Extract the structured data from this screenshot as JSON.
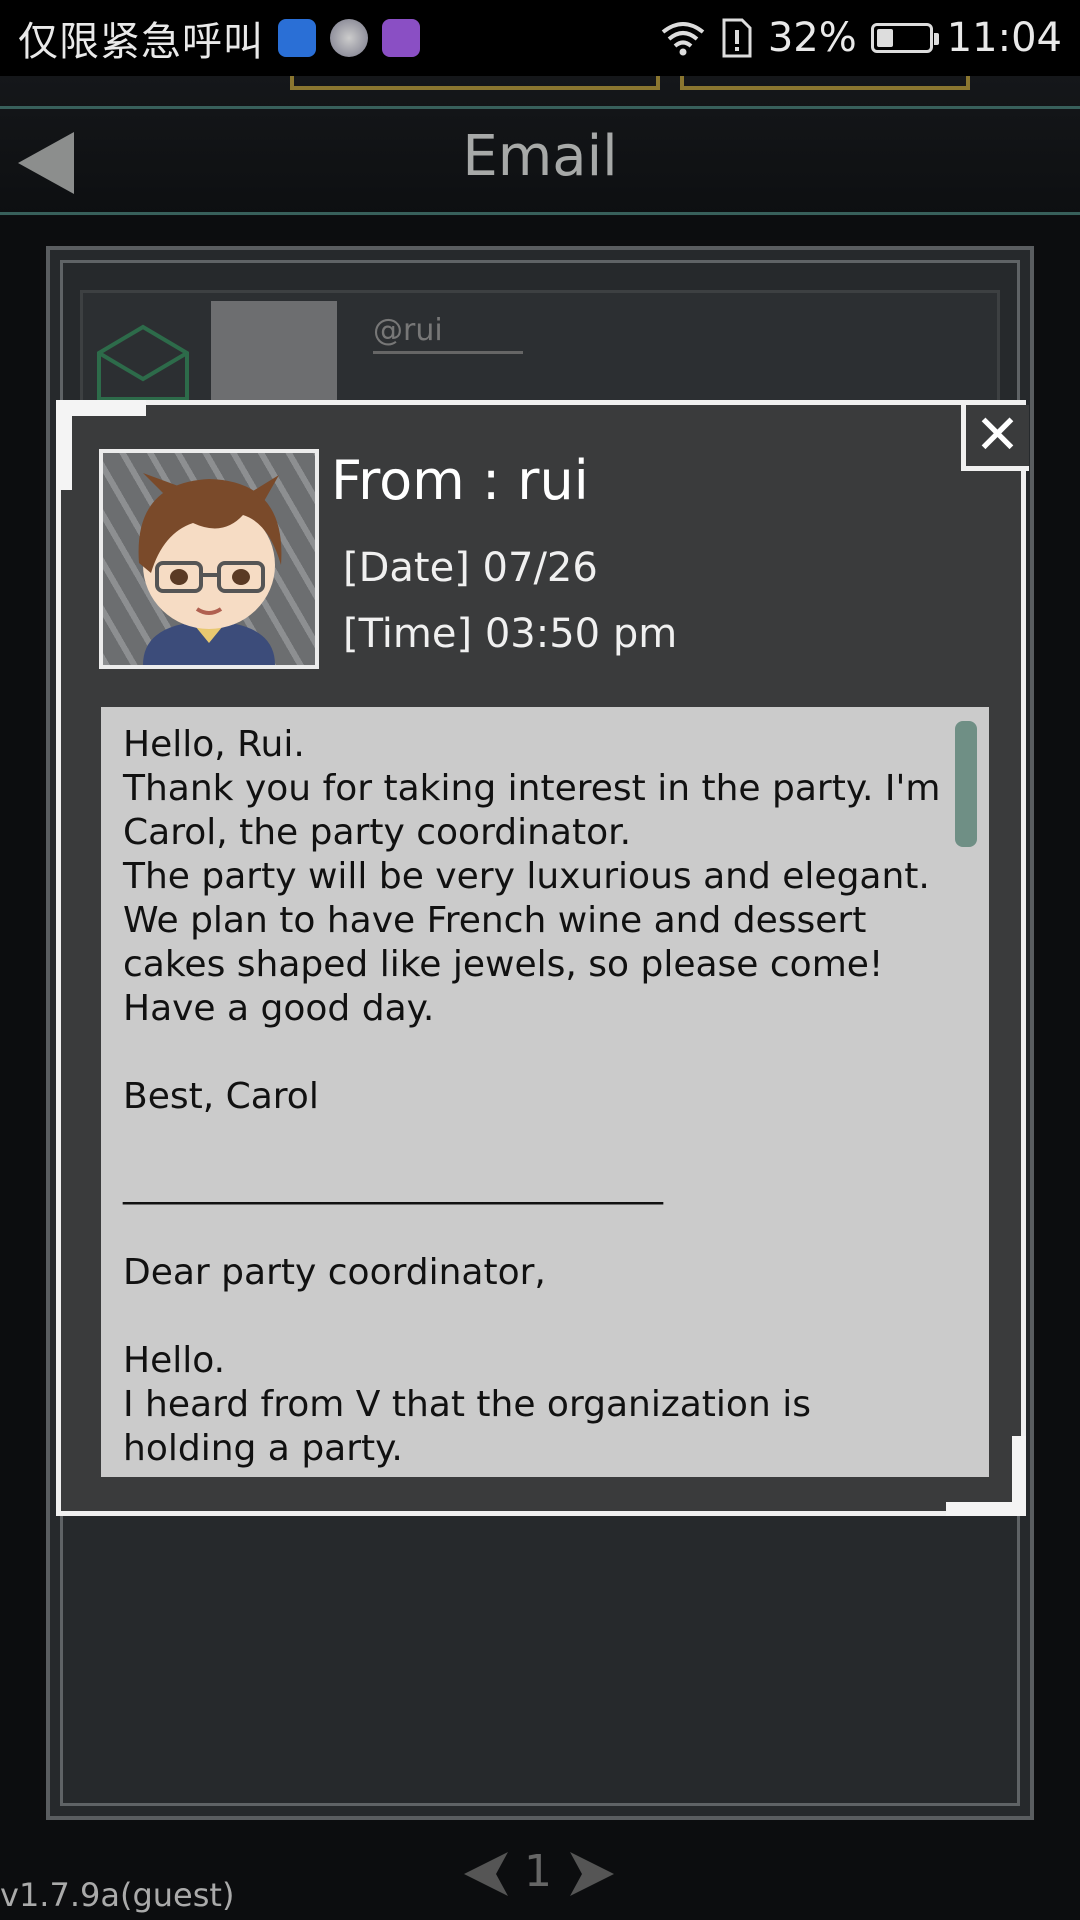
{
  "status_bar": {
    "carrier": "仅限紧急呼叫",
    "battery_percent": "32%",
    "time": "11:04",
    "battery_level": 0.32
  },
  "header": {
    "title": "Email"
  },
  "background_list": {
    "first_handle": "@rui"
  },
  "dialog": {
    "from": "From : rui",
    "date_label": "[Date]",
    "date_value": "07/26",
    "time_label": "[Time]",
    "time_value": "03:50 pm",
    "message": "Hello, Rui.\nThank you for taking interest in the party. I'm Carol, the party coordinator.\nThe party will be very luxurious and elegant.\nWe plan to have French wine and dessert cakes shaped like jewels, so please come!\nHave a good day.\n\nBest, Carol\n\n______________________________\n\nDear party coordinator,\n\nHello.\nI heard from V that the organization is holding a party."
  },
  "pager": {
    "page": "1"
  },
  "version": "v1.7.9a(guest)"
}
